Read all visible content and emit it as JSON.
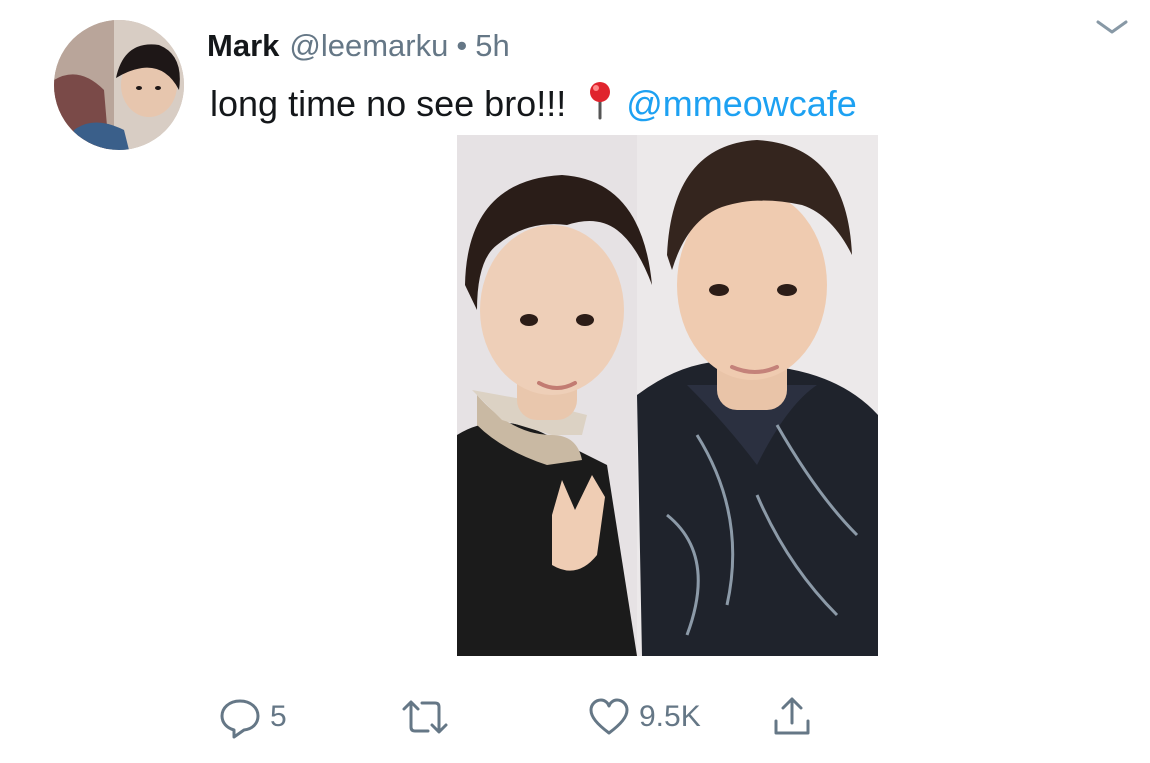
{
  "tweet": {
    "author_name": "Mark",
    "handle": "@leemarku",
    "separator": "•",
    "time": "5h",
    "text": "long time no see bro!!!",
    "location_icon": "round-pushpin-icon",
    "mention": "@mmeowcafe"
  },
  "actions": {
    "reply_count": "5",
    "retweet_count": "",
    "like_count": "9.5K"
  },
  "colors": {
    "text": "#14171a",
    "secondary": "#657786",
    "link": "#1da1f2"
  }
}
